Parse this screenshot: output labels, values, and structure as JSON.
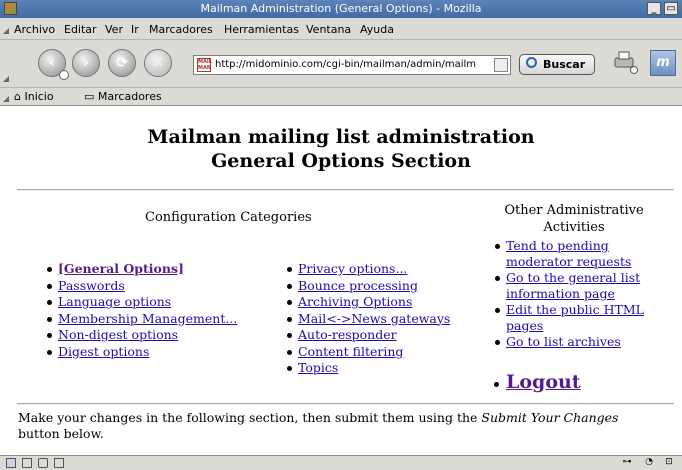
{
  "window": {
    "title": "Mailman Administration (General Options) - Mozilla",
    "min_glyph": "_",
    "max_glyph": "▭"
  },
  "menu": {
    "items": [
      "Archivo",
      "Editar",
      "Ver",
      "Ir",
      "Marcadores",
      "Herramientas",
      "Ventana",
      "Ayuda"
    ]
  },
  "nav": {
    "url": "http://midominio.com/cgi-bin/mailman/admin/mailm",
    "favicon_text": "MAIL MAN",
    "search_label": "Buscar",
    "back_glyph": "‹",
    "forward_glyph": "›",
    "reload_glyph": "⟳",
    "stop_glyph": "✕",
    "throbber_glyph": "m"
  },
  "personal_toolbar": {
    "home": "Inicio",
    "bookmarks": "Marcadores"
  },
  "page": {
    "title_line1": "Mailman mailing list administration",
    "title_line2": "General Options Section",
    "config_heading": "Configuration Categories",
    "other_heading_line1": "Other Administrative",
    "other_heading_line2": "Activities",
    "categories_left": [
      "[General Options]",
      "Passwords",
      "Language options",
      "Membership Management...",
      "Non-digest options",
      "Digest options"
    ],
    "categories_right": [
      "Privacy options...",
      "Bounce processing",
      "Archiving Options",
      "Mail<->News gateways",
      "Auto-responder",
      "Content filtering",
      "Topics"
    ],
    "other_links": [
      "Tend to pending moderator requests",
      "Go to the general list information page",
      "Edit the public HTML pages",
      "Go to list archives"
    ],
    "logout": "Logout",
    "instructions_before": "Make your changes in the following section, then submit them using the ",
    "instructions_em": "Submit Your Changes",
    "instructions_after": " button below."
  },
  "colors": {
    "link": "#1a0dab",
    "visited_link": "#551a8b",
    "titlebar": "#4a74ac",
    "chrome": "#dcdad5"
  }
}
